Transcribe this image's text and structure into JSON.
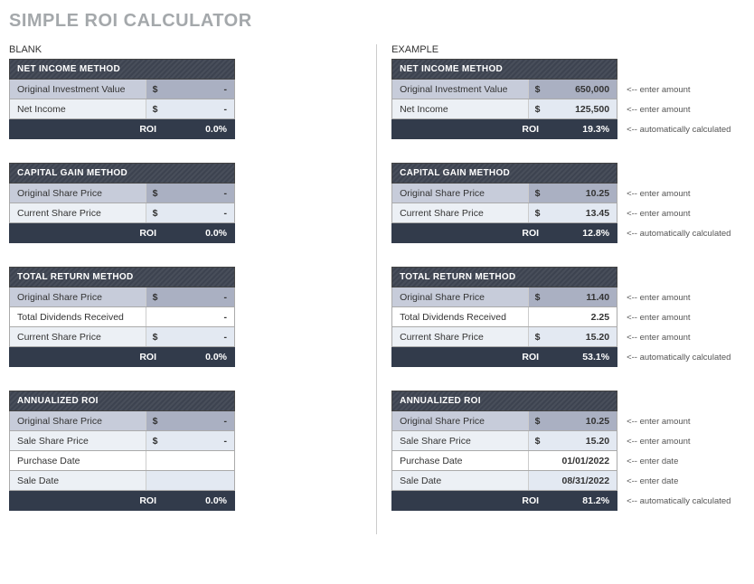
{
  "title": "SIMPLE ROI CALCULATOR",
  "columns": {
    "blank": "BLANK",
    "example": "EXAMPLE"
  },
  "hints": {
    "amount": "<-- enter amount",
    "date": "<-- enter date",
    "calc": "<-- automatically calculated"
  },
  "sections": {
    "net_income": {
      "header": "NET INCOME METHOD",
      "rows": {
        "orig_invest": "Original Investment Value",
        "net_income": "Net Income"
      },
      "roi_label": "ROI"
    },
    "capital_gain": {
      "header": "CAPITAL GAIN METHOD",
      "rows": {
        "orig_share": "Original Share Price",
        "curr_share": "Current Share Price"
      },
      "roi_label": "ROI"
    },
    "total_return": {
      "header": "TOTAL RETURN METHOD",
      "rows": {
        "orig_share": "Original Share Price",
        "dividends": "Total Dividends Received",
        "curr_share": "Current Share Price"
      },
      "roi_label": "ROI"
    },
    "annualized": {
      "header": "ANNUALIZED ROI",
      "rows": {
        "orig_share": "Original Share Price",
        "sale_share": "Sale Share Price",
        "purchase_date": "Purchase Date",
        "sale_date": "Sale Date"
      },
      "roi_label": "ROI"
    }
  },
  "blank": {
    "currency": "$",
    "dash": "-",
    "roi": "0.0%"
  },
  "example": {
    "currency": "$",
    "net_income": {
      "orig_invest": "650,000",
      "net_income": "125,500",
      "roi": "19.3%"
    },
    "capital_gain": {
      "orig_share": "10.25",
      "curr_share": "13.45",
      "roi": "12.8%"
    },
    "total_return": {
      "orig_share": "11.40",
      "dividends": "2.25",
      "curr_share": "15.20",
      "roi": "53.1%"
    },
    "annualized": {
      "orig_share": "10.25",
      "sale_share": "15.20",
      "purchase_date": "01/01/2022",
      "sale_date": "08/31/2022",
      "roi": "81.2%"
    }
  }
}
